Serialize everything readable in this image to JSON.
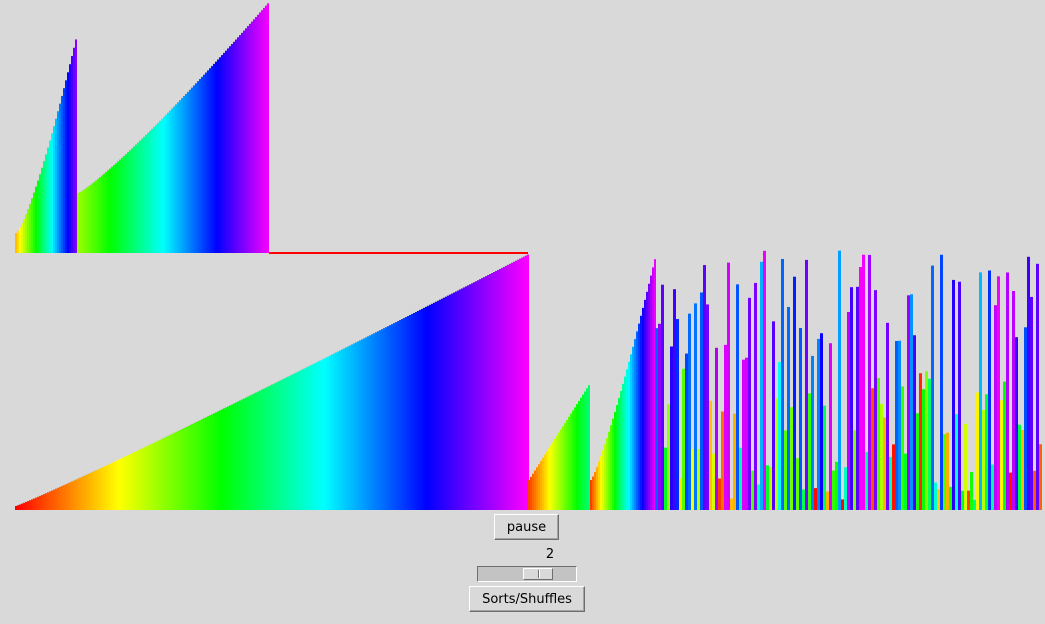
{
  "controls": {
    "pause_label": "pause",
    "speed_value": "2",
    "speed_slider_fraction": 0.66,
    "sorts_label": "Sorts/Shuffles"
  },
  "visualization": {
    "description_colors": "rainbow hue by value, red→yellow→green→cyan→blue→magenta→red",
    "baseline_color": "#ff0000"
  }
}
